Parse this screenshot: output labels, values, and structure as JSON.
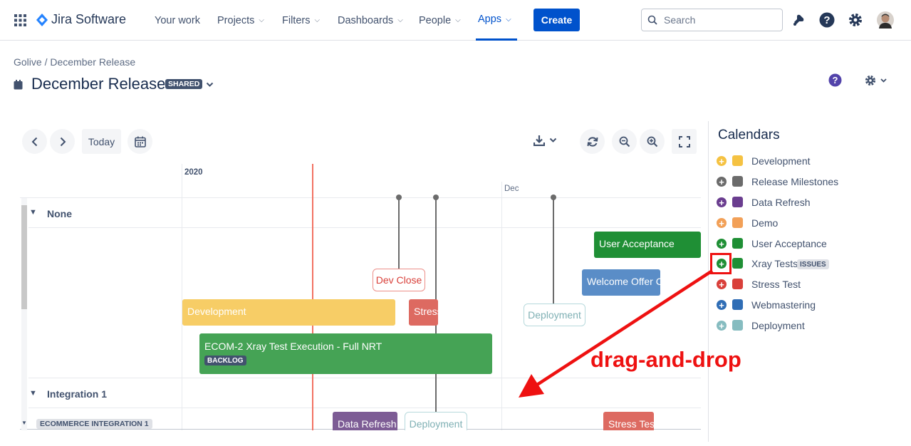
{
  "nav": {
    "brand": "Jira Software",
    "items": [
      "Your work",
      "Projects",
      "Filters",
      "Dashboards",
      "People",
      "Apps"
    ],
    "create_label": "Create",
    "search_placeholder": "Search"
  },
  "header": {
    "breadcrumb": "Golive  /  December Release",
    "title": "December Release",
    "shared_badge": "SHARED"
  },
  "toolbar": {
    "today_label": "Today"
  },
  "timeline": {
    "year_label": "2020",
    "month_label": "Dec",
    "groups": [
      "None",
      "Integration 1"
    ],
    "subgroup_badge": "ECOMMERCE INTEGRATION 1",
    "bars": {
      "user_acceptance": "User Acceptance",
      "welcome_offer": "Welcome Offer C",
      "development": "Development",
      "stress": "Stress",
      "ecom_execution": "ECOM-2 Xray Test Execution - Full NRT",
      "ecom_badge": "BACKLOG",
      "data_refresh": "Data Refresh",
      "stress_test": "Stress Test"
    },
    "milestones": {
      "dev_close": "Dev Close",
      "deployment_1": "Deployment",
      "deployment_2": "Deployment"
    }
  },
  "calendars": {
    "title": "Calendars",
    "items": [
      {
        "name": "Development",
        "color": "#f5c242"
      },
      {
        "name": "Release Milestones",
        "color": "#6b6b6b"
      },
      {
        "name": "Data Refresh",
        "color": "#6a3d8f"
      },
      {
        "name": "Demo",
        "color": "#f2a057"
      },
      {
        "name": "User Acceptance",
        "color": "#1f8f35"
      },
      {
        "name": "Xray Tests",
        "color": "#1f8f35",
        "badge": "ISSUES"
      },
      {
        "name": "Stress Test",
        "color": "#d9403a"
      },
      {
        "name": "Webmastering",
        "color": "#2f6db5"
      },
      {
        "name": "Deployment",
        "color": "#86bcc0"
      }
    ]
  },
  "annotation": {
    "text": "drag-and-drop",
    "color": "#ee1111"
  }
}
